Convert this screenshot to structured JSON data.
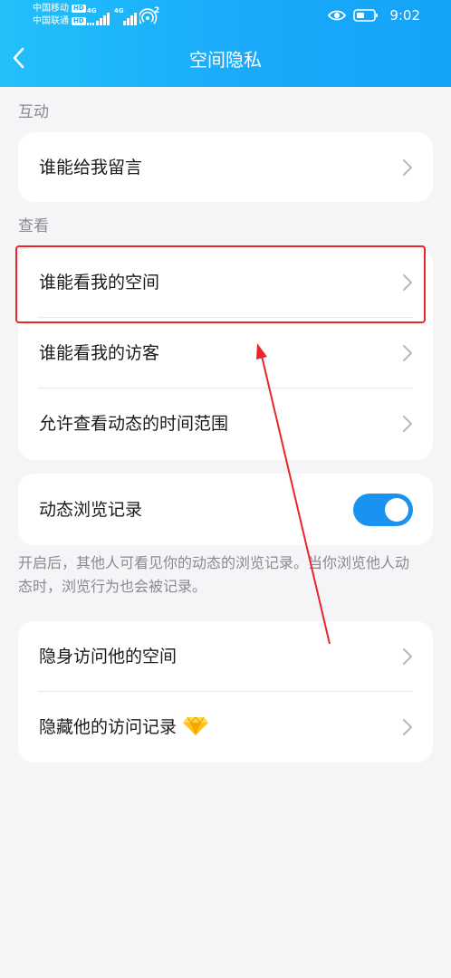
{
  "status_bar": {
    "carrier_1": "中国移动",
    "carrier_2": "中国联通",
    "hd_badge": "HD",
    "network_1": "4G",
    "network_2": "4G",
    "hotspot_count": "2",
    "time": "9:02"
  },
  "nav": {
    "title": "空间隐私"
  },
  "sections": {
    "interaction": {
      "label": "互动",
      "items": [
        {
          "label": "谁能给我留言"
        }
      ]
    },
    "view": {
      "label": "查看",
      "items": [
        {
          "label": "谁能看我的空间"
        },
        {
          "label": "谁能看我的访客"
        },
        {
          "label": "允许查看动态的时间范围"
        }
      ]
    },
    "browse_record": {
      "label": "动态浏览记录",
      "enabled": true,
      "hint": "开启后，其他人可看见你的动态的浏览记录。当你浏览他人动态时，浏览行为也会被记录。"
    },
    "stealth": {
      "items": [
        {
          "label": "隐身访问他的空间"
        },
        {
          "label": "隐藏他的访问记录",
          "badge_icon": "diamond-icon"
        }
      ]
    }
  },
  "colors": {
    "header_start": "#22c0fb",
    "header_end": "#14a3f7",
    "toggle_on": "#1a93f0",
    "annotation_red": "#e8262b",
    "background": "#f5f5f7"
  }
}
